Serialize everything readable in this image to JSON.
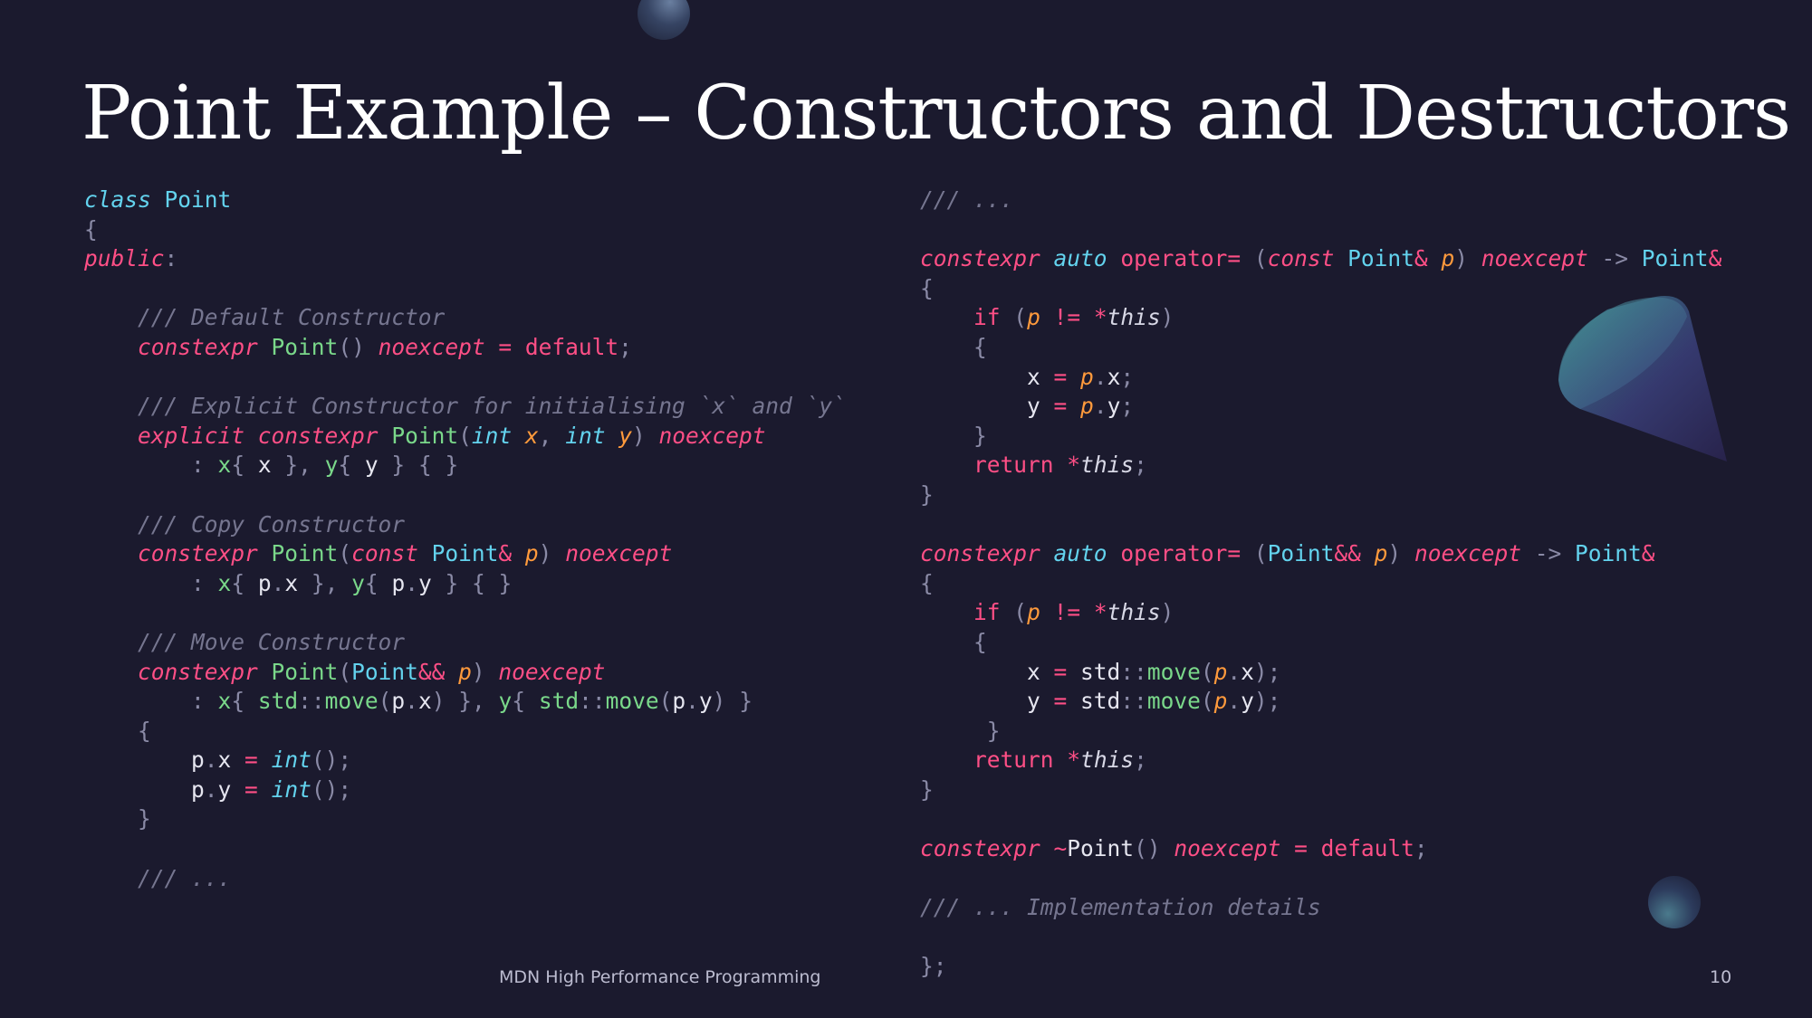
{
  "title": "Point Example – Constructors and Destructors",
  "footer": {
    "text": "MDN High Performance Programming",
    "page_number": "10"
  },
  "colors": {
    "background": "#1b1a2e",
    "keyword": "#ff4f86",
    "type": "#63d3ee",
    "function": "#7ad88a",
    "parameter": "#ff9a3c",
    "comment": "#767690",
    "text": "#d8d8e6"
  },
  "decorations": [
    "orb-top",
    "cone",
    "orb-bottom"
  ],
  "code_left": [
    [
      [
        "type",
        "class"
      ],
      [
        "plain",
        " "
      ],
      [
        "cls",
        "Point"
      ]
    ],
    [
      [
        "punc",
        "{"
      ]
    ],
    [
      [
        "kw",
        "public"
      ],
      [
        "punc",
        ":"
      ]
    ],
    [],
    [
      [
        "plain",
        "    "
      ],
      [
        "com",
        "/// Default Constructor"
      ]
    ],
    [
      [
        "plain",
        "    "
      ],
      [
        "kw",
        "constexpr"
      ],
      [
        "plain",
        " "
      ],
      [
        "fn",
        "Point"
      ],
      [
        "punc",
        "()"
      ],
      [
        "plain",
        " "
      ],
      [
        "kw",
        "noexcept"
      ],
      [
        "plain",
        " "
      ],
      [
        "op",
        "="
      ],
      [
        "plain",
        " "
      ],
      [
        "op",
        "default"
      ],
      [
        "punc",
        ";"
      ]
    ],
    [],
    [
      [
        "plain",
        "    "
      ],
      [
        "com",
        "/// Explicit Constructor for initialising `x` and `y`"
      ]
    ],
    [
      [
        "plain",
        "    "
      ],
      [
        "kw",
        "explicit"
      ],
      [
        "plain",
        " "
      ],
      [
        "kw",
        "constexpr"
      ],
      [
        "plain",
        " "
      ],
      [
        "fn",
        "Point"
      ],
      [
        "punc",
        "("
      ],
      [
        "type",
        "int"
      ],
      [
        "plain",
        " "
      ],
      [
        "param",
        "x"
      ],
      [
        "punc",
        ","
      ],
      [
        "plain",
        " "
      ],
      [
        "type",
        "int"
      ],
      [
        "plain",
        " "
      ],
      [
        "param",
        "y"
      ],
      [
        "punc",
        ")"
      ],
      [
        "plain",
        " "
      ],
      [
        "kw",
        "noexcept"
      ]
    ],
    [
      [
        "plain",
        "        "
      ],
      [
        "punc",
        ":"
      ],
      [
        "plain",
        " "
      ],
      [
        "fn",
        "x"
      ],
      [
        "punc",
        "{"
      ],
      [
        "plain",
        " x "
      ],
      [
        "punc",
        "},"
      ],
      [
        "plain",
        " "
      ],
      [
        "fn",
        "y"
      ],
      [
        "punc",
        "{"
      ],
      [
        "plain",
        " y "
      ],
      [
        "punc",
        "}"
      ],
      [
        "plain",
        " "
      ],
      [
        "punc",
        "{"
      ],
      [
        "plain",
        " "
      ],
      [
        "punc",
        "}"
      ]
    ],
    [],
    [
      [
        "plain",
        "    "
      ],
      [
        "com",
        "/// Copy Constructor"
      ]
    ],
    [
      [
        "plain",
        "    "
      ],
      [
        "kw",
        "constexpr"
      ],
      [
        "plain",
        " "
      ],
      [
        "fn",
        "Point"
      ],
      [
        "punc",
        "("
      ],
      [
        "kw",
        "const"
      ],
      [
        "plain",
        " "
      ],
      [
        "cls",
        "Point"
      ],
      [
        "op",
        "&"
      ],
      [
        "plain",
        " "
      ],
      [
        "param",
        "p"
      ],
      [
        "punc",
        ")"
      ],
      [
        "plain",
        " "
      ],
      [
        "kw",
        "noexcept"
      ]
    ],
    [
      [
        "plain",
        "        "
      ],
      [
        "punc",
        ":"
      ],
      [
        "plain",
        " "
      ],
      [
        "fn",
        "x"
      ],
      [
        "punc",
        "{"
      ],
      [
        "plain",
        " p"
      ],
      [
        "punc",
        "."
      ],
      [
        "plain",
        "x "
      ],
      [
        "punc",
        "},"
      ],
      [
        "plain",
        " "
      ],
      [
        "fn",
        "y"
      ],
      [
        "punc",
        "{"
      ],
      [
        "plain",
        " p"
      ],
      [
        "punc",
        "."
      ],
      [
        "plain",
        "y "
      ],
      [
        "punc",
        "}"
      ],
      [
        "plain",
        " "
      ],
      [
        "punc",
        "{"
      ],
      [
        "plain",
        " "
      ],
      [
        "punc",
        "}"
      ]
    ],
    [],
    [
      [
        "plain",
        "    "
      ],
      [
        "com",
        "/// Move Constructor"
      ]
    ],
    [
      [
        "plain",
        "    "
      ],
      [
        "kw",
        "constexpr"
      ],
      [
        "plain",
        " "
      ],
      [
        "fn",
        "Point"
      ],
      [
        "punc",
        "("
      ],
      [
        "cls",
        "Point"
      ],
      [
        "op",
        "&&"
      ],
      [
        "plain",
        " "
      ],
      [
        "param",
        "p"
      ],
      [
        "punc",
        ")"
      ],
      [
        "plain",
        " "
      ],
      [
        "kw",
        "noexcept"
      ]
    ],
    [
      [
        "plain",
        "        "
      ],
      [
        "punc",
        ":"
      ],
      [
        "plain",
        " "
      ],
      [
        "fn",
        "x"
      ],
      [
        "punc",
        "{"
      ],
      [
        "plain",
        " "
      ],
      [
        "fn",
        "std"
      ],
      [
        "punc",
        "::"
      ],
      [
        "fn",
        "move"
      ],
      [
        "punc",
        "("
      ],
      [
        "plain",
        "p"
      ],
      [
        "punc",
        "."
      ],
      [
        "plain",
        "x"
      ],
      [
        "punc",
        ")"
      ],
      [
        "plain",
        " "
      ],
      [
        "punc",
        "},"
      ],
      [
        "plain",
        " "
      ],
      [
        "fn",
        "y"
      ],
      [
        "punc",
        "{"
      ],
      [
        "plain",
        " "
      ],
      [
        "fn",
        "std"
      ],
      [
        "punc",
        "::"
      ],
      [
        "fn",
        "move"
      ],
      [
        "punc",
        "("
      ],
      [
        "plain",
        "p"
      ],
      [
        "punc",
        "."
      ],
      [
        "plain",
        "y"
      ],
      [
        "punc",
        ")"
      ],
      [
        "plain",
        " "
      ],
      [
        "punc",
        "}"
      ]
    ],
    [
      [
        "plain",
        "    "
      ],
      [
        "punc",
        "{"
      ]
    ],
    [
      [
        "plain",
        "        p"
      ],
      [
        "punc",
        "."
      ],
      [
        "plain",
        "x "
      ],
      [
        "op",
        "="
      ],
      [
        "plain",
        " "
      ],
      [
        "type",
        "int"
      ],
      [
        "punc",
        "();"
      ]
    ],
    [
      [
        "plain",
        "        p"
      ],
      [
        "punc",
        "."
      ],
      [
        "plain",
        "y "
      ],
      [
        "op",
        "="
      ],
      [
        "plain",
        " "
      ],
      [
        "type",
        "int"
      ],
      [
        "punc",
        "();"
      ]
    ],
    [
      [
        "plain",
        "    "
      ],
      [
        "punc",
        "}"
      ]
    ],
    [],
    [
      [
        "plain",
        "    "
      ],
      [
        "com",
        "/// ..."
      ]
    ]
  ],
  "code_right": [
    [
      [
        "com",
        "/// ..."
      ]
    ],
    [],
    [
      [
        "kw",
        "constexpr"
      ],
      [
        "plain",
        " "
      ],
      [
        "type",
        "auto"
      ],
      [
        "plain",
        " "
      ],
      [
        "op",
        "operator="
      ],
      [
        "plain",
        " "
      ],
      [
        "punc",
        "("
      ],
      [
        "kw",
        "const"
      ],
      [
        "plain",
        " "
      ],
      [
        "cls",
        "Point"
      ],
      [
        "op",
        "&"
      ],
      [
        "plain",
        " "
      ],
      [
        "param",
        "p"
      ],
      [
        "punc",
        ")"
      ],
      [
        "plain",
        " "
      ],
      [
        "kw",
        "noexcept"
      ],
      [
        "plain",
        " "
      ],
      [
        "punc",
        "->"
      ],
      [
        "plain",
        " "
      ],
      [
        "cls",
        "Point"
      ],
      [
        "op",
        "&"
      ]
    ],
    [
      [
        "punc",
        "{"
      ]
    ],
    [
      [
        "plain",
        "    "
      ],
      [
        "op",
        "if"
      ],
      [
        "plain",
        " "
      ],
      [
        "punc",
        "("
      ],
      [
        "param",
        "p"
      ],
      [
        "plain",
        " "
      ],
      [
        "op",
        "!="
      ],
      [
        "plain",
        " "
      ],
      [
        "op",
        "*"
      ],
      [
        "this",
        "this"
      ],
      [
        "punc",
        ")"
      ]
    ],
    [
      [
        "plain",
        "    "
      ],
      [
        "punc",
        "{"
      ]
    ],
    [
      [
        "plain",
        "        x "
      ],
      [
        "op",
        "="
      ],
      [
        "plain",
        " "
      ],
      [
        "param",
        "p"
      ],
      [
        "punc",
        "."
      ],
      [
        "plain",
        "x"
      ],
      [
        "punc",
        ";"
      ]
    ],
    [
      [
        "plain",
        "        y "
      ],
      [
        "op",
        "="
      ],
      [
        "plain",
        " "
      ],
      [
        "param",
        "p"
      ],
      [
        "punc",
        "."
      ],
      [
        "plain",
        "y"
      ],
      [
        "punc",
        ";"
      ]
    ],
    [
      [
        "plain",
        "    "
      ],
      [
        "punc",
        "}"
      ]
    ],
    [
      [
        "plain",
        "    "
      ],
      [
        "op",
        "return"
      ],
      [
        "plain",
        " "
      ],
      [
        "op",
        "*"
      ],
      [
        "this",
        "this"
      ],
      [
        "punc",
        ";"
      ]
    ],
    [
      [
        "punc",
        "}"
      ]
    ],
    [],
    [
      [
        "kw",
        "constexpr"
      ],
      [
        "plain",
        " "
      ],
      [
        "type",
        "auto"
      ],
      [
        "plain",
        " "
      ],
      [
        "op",
        "operator="
      ],
      [
        "plain",
        " "
      ],
      [
        "punc",
        "("
      ],
      [
        "cls",
        "Point"
      ],
      [
        "op",
        "&&"
      ],
      [
        "plain",
        " "
      ],
      [
        "param",
        "p"
      ],
      [
        "punc",
        ")"
      ],
      [
        "plain",
        " "
      ],
      [
        "kw",
        "noexcept"
      ],
      [
        "plain",
        " "
      ],
      [
        "punc",
        "->"
      ],
      [
        "plain",
        " "
      ],
      [
        "cls",
        "Point"
      ],
      [
        "op",
        "&"
      ]
    ],
    [
      [
        "punc",
        "{"
      ]
    ],
    [
      [
        "plain",
        "    "
      ],
      [
        "op",
        "if"
      ],
      [
        "plain",
        " "
      ],
      [
        "punc",
        "("
      ],
      [
        "param",
        "p"
      ],
      [
        "plain",
        " "
      ],
      [
        "op",
        "!="
      ],
      [
        "plain",
        " "
      ],
      [
        "op",
        "*"
      ],
      [
        "this",
        "this"
      ],
      [
        "punc",
        ")"
      ]
    ],
    [
      [
        "plain",
        "    "
      ],
      [
        "punc",
        "{"
      ]
    ],
    [
      [
        "plain",
        "        x "
      ],
      [
        "op",
        "="
      ],
      [
        "plain",
        " std"
      ],
      [
        "punc",
        "::"
      ],
      [
        "fn",
        "move"
      ],
      [
        "punc",
        "("
      ],
      [
        "param",
        "p"
      ],
      [
        "punc",
        "."
      ],
      [
        "plain",
        "x"
      ],
      [
        "punc",
        ");"
      ]
    ],
    [
      [
        "plain",
        "        y "
      ],
      [
        "op",
        "="
      ],
      [
        "plain",
        " std"
      ],
      [
        "punc",
        "::"
      ],
      [
        "fn",
        "move"
      ],
      [
        "punc",
        "("
      ],
      [
        "param",
        "p"
      ],
      [
        "punc",
        "."
      ],
      [
        "plain",
        "y"
      ],
      [
        "punc",
        ");"
      ]
    ],
    [
      [
        "plain",
        "     "
      ],
      [
        "punc",
        "}"
      ]
    ],
    [
      [
        "plain",
        "    "
      ],
      [
        "op",
        "return"
      ],
      [
        "plain",
        " "
      ],
      [
        "op",
        "*"
      ],
      [
        "this",
        "this"
      ],
      [
        "punc",
        ";"
      ]
    ],
    [
      [
        "punc",
        "}"
      ]
    ],
    [],
    [
      [
        "kw",
        "constexpr"
      ],
      [
        "plain",
        " "
      ],
      [
        "op",
        "~"
      ],
      [
        "plain",
        "Point"
      ],
      [
        "punc",
        "()"
      ],
      [
        "plain",
        " "
      ],
      [
        "kw",
        "noexcept"
      ],
      [
        "plain",
        " "
      ],
      [
        "op",
        "="
      ],
      [
        "plain",
        " "
      ],
      [
        "op",
        "default"
      ],
      [
        "punc",
        ";"
      ]
    ],
    [],
    [
      [
        "com",
        "/// ..."
      ],
      [
        "com",
        " Implementation details"
      ]
    ],
    [],
    [
      [
        "punc",
        "};"
      ]
    ]
  ]
}
